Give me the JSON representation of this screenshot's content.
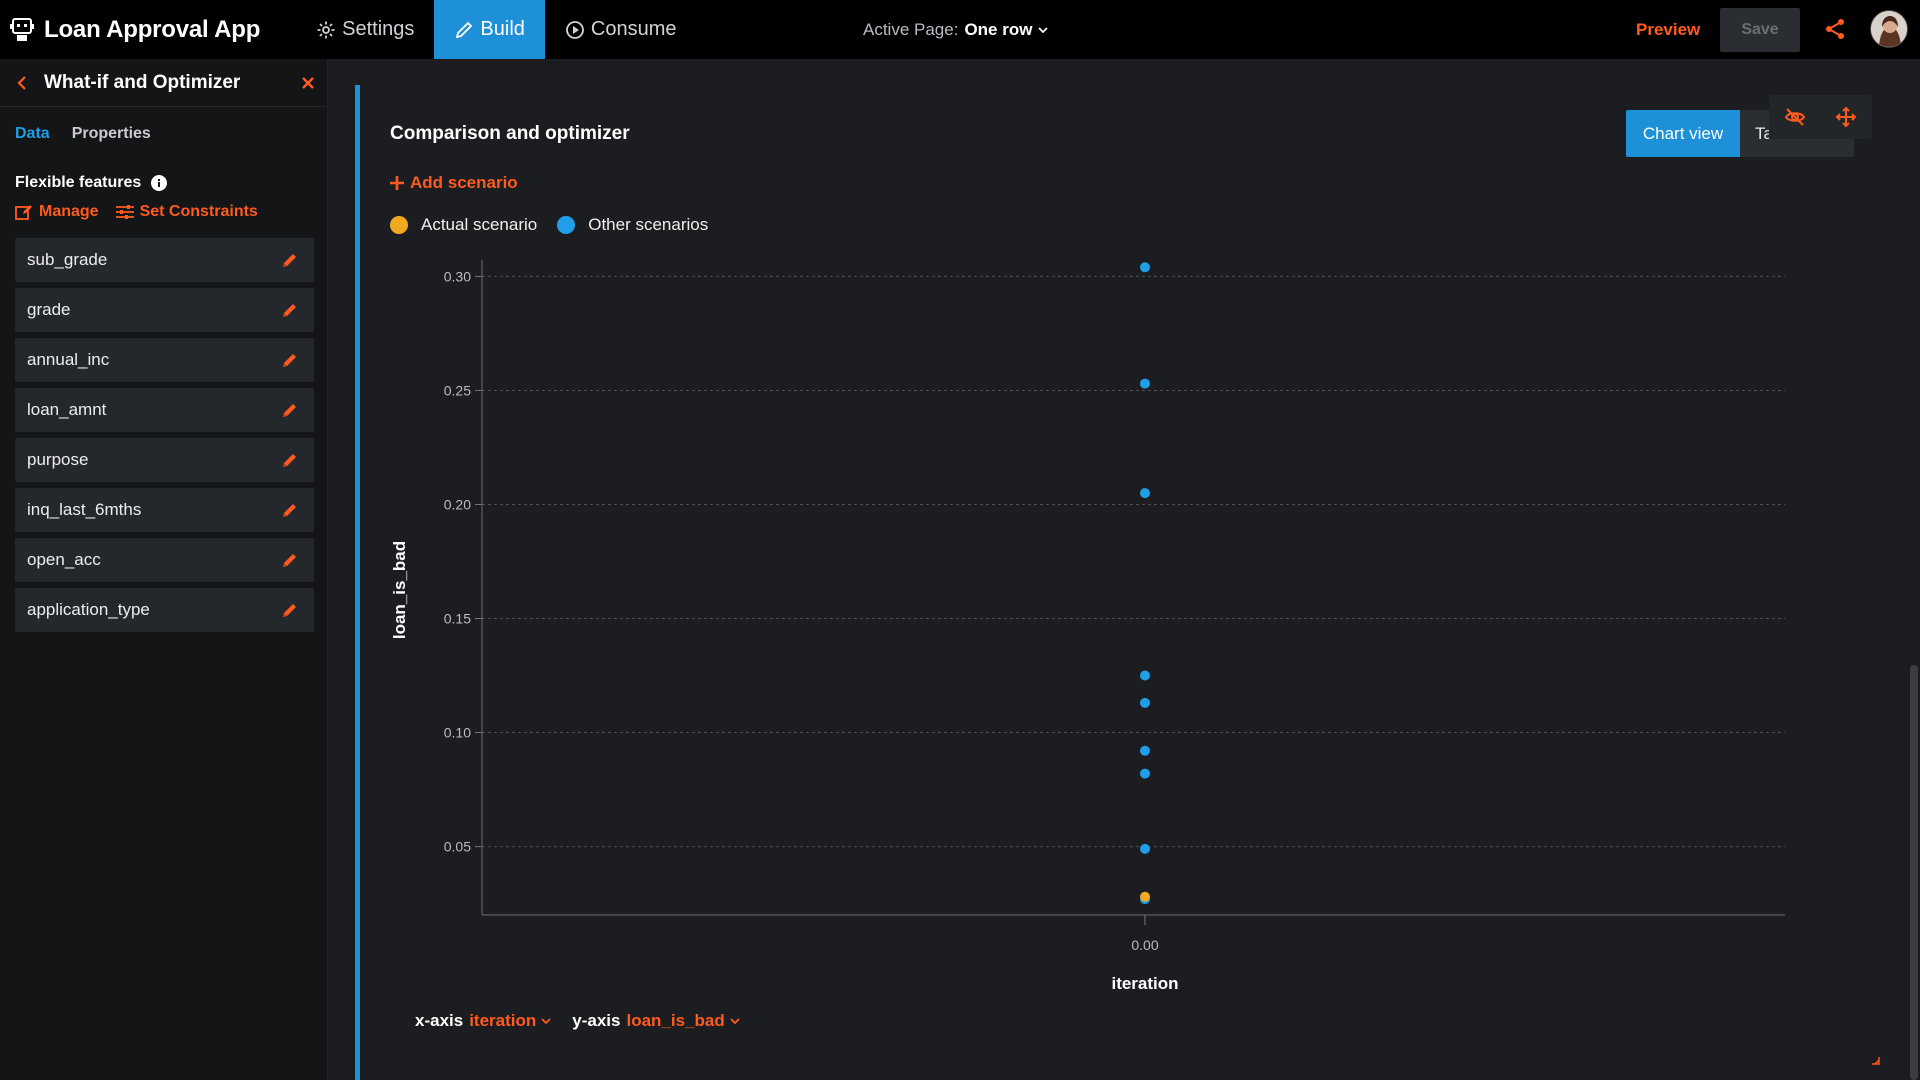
{
  "app": {
    "title": "Loan Approval App",
    "nav": [
      {
        "label": "Settings",
        "icon": "gear-icon"
      },
      {
        "label": "Build",
        "icon": "pencil-icon",
        "active": true
      },
      {
        "label": "Consume",
        "icon": "play-circle-icon"
      }
    ],
    "active_page_label": "Active Page:",
    "active_page_value": "One row",
    "preview_label": "Preview",
    "save_label": "Save"
  },
  "sidebar": {
    "title": "What-if and Optimizer",
    "tabs": [
      {
        "label": "Data",
        "active": true
      },
      {
        "label": "Properties"
      }
    ],
    "flex_title": "Flexible features",
    "actions": [
      {
        "label": "Manage",
        "icon": "edit-box-icon"
      },
      {
        "label": "Set Constraints",
        "icon": "sliders-icon"
      }
    ],
    "features": [
      "sub_grade",
      "grade",
      "annual_inc",
      "loan_amnt",
      "purpose",
      "inq_last_6mths",
      "open_acc",
      "application_type"
    ]
  },
  "panel": {
    "title": "Comparison and optimizer",
    "view_active": "Chart view",
    "view_other": "Ta",
    "add_scenario": "Add scenario",
    "legend": [
      {
        "label": "Actual scenario",
        "color": "#f2a922"
      },
      {
        "label": "Other scenarios",
        "color": "#1e9fe8"
      }
    ],
    "x_axis_label": "x-axis",
    "x_axis_value": "iteration",
    "y_axis_label": "y-axis",
    "y_axis_value": "loan_is_bad"
  },
  "chart_data": {
    "type": "scatter",
    "xlabel": "iteration",
    "ylabel": "loan_is_bad",
    "x_ticks": [
      "0.00"
    ],
    "y_ticks": [
      "0.05",
      "0.10",
      "0.15",
      "0.20",
      "0.25",
      "0.30"
    ],
    "ylim": [
      0.02,
      0.305
    ],
    "grid": true,
    "series": [
      {
        "name": "Actual scenario",
        "color": "#f2a922",
        "points": [
          {
            "x": 0,
            "y": 0.028
          }
        ]
      },
      {
        "name": "Other scenarios",
        "color": "#1e9fe8",
        "points": [
          {
            "x": 0,
            "y": 0.304
          },
          {
            "x": 0,
            "y": 0.253
          },
          {
            "x": 0,
            "y": 0.205
          },
          {
            "x": 0,
            "y": 0.125
          },
          {
            "x": 0,
            "y": 0.113
          },
          {
            "x": 0,
            "y": 0.092
          },
          {
            "x": 0,
            "y": 0.082
          },
          {
            "x": 0,
            "y": 0.049
          },
          {
            "x": 0,
            "y": 0.027
          }
        ]
      }
    ]
  }
}
